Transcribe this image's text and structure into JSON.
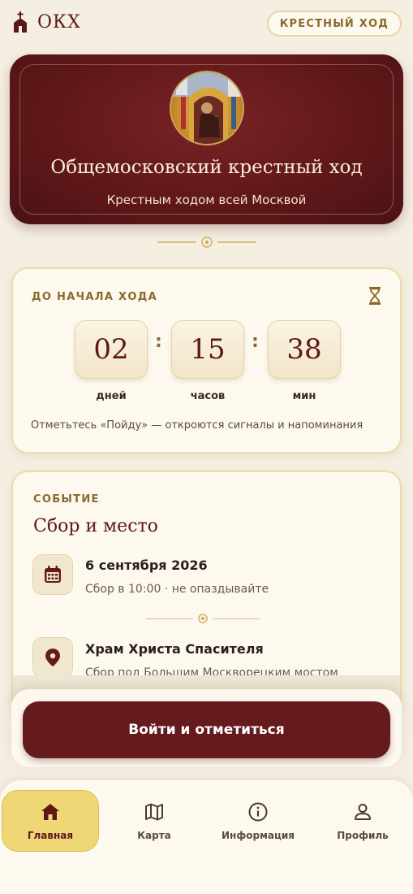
{
  "header": {
    "brand": "ОКХ",
    "pill_label": "КРЕСТНЫЙ ХОД"
  },
  "hero": {
    "title": "Общемосковский крестный ход",
    "subtitle": "Крестным ходом всей Москвой"
  },
  "countdown": {
    "label": "ДО НАЧАЛА ХОДА",
    "days": "02",
    "hours": "15",
    "minutes": "38",
    "days_unit": "дней",
    "hours_unit": "часов",
    "minutes_unit": "мин",
    "hint": "Отметьтесь «Пойду» — откроются сигналы и напоминания"
  },
  "event": {
    "label": "СОБЫТИЕ",
    "title": "Сбор и место",
    "date": "6 сентября 2026",
    "date_note": "Сбор в 10:00 · не опаздывайте",
    "place": "Храм Христа Спасителя",
    "place_note": "Сбор под Большим Москворецким мостом"
  },
  "cta": {
    "label": "Войти и отметиться"
  },
  "nav": {
    "home": "Главная",
    "map": "Карта",
    "info": "Информация",
    "profile": "Профиль"
  },
  "colors": {
    "accent": "#651a1d",
    "gold": "#8a6a2c",
    "background": "#f5efe2",
    "active_tab": "#f0d776"
  }
}
